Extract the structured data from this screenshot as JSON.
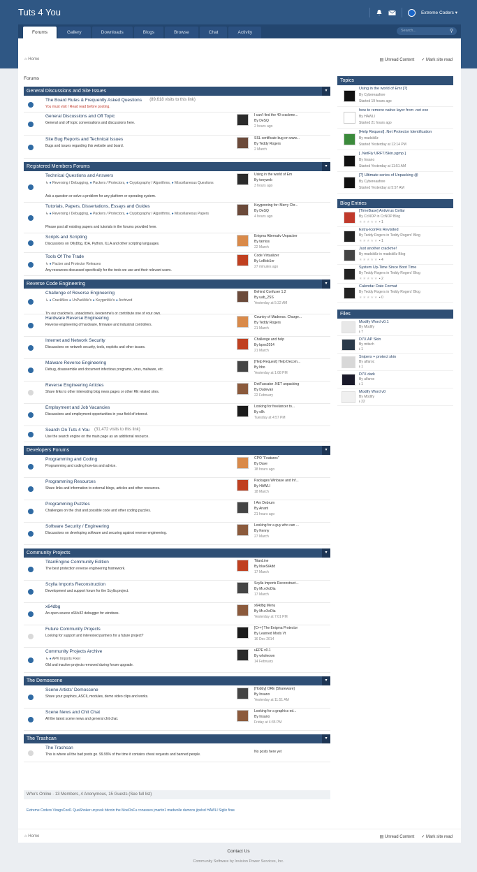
{
  "site": {
    "title": "Tuts 4 You"
  },
  "user": {
    "name": "Extreme Coders ▾"
  },
  "nav": {
    "tabs": [
      "Forums",
      "Gallery",
      "Downloads",
      "Blogs",
      "Browse",
      "Chat",
      "Activity"
    ],
    "search_placeholder": "Search..."
  },
  "breadcrumb": {
    "home": "Home",
    "unread": "Unread Content",
    "mark_read": "Mark site read"
  },
  "forum_label": "Forums",
  "categories": [
    {
      "title": "General Discussions and Site Issues",
      "rows": [
        {
          "title": "The Board Rules & Frequently Asked Questions",
          "extra": "(89,618 visits to this link)",
          "desc": "You must visit / Read read before posting.",
          "red": true,
          "h": 23
        },
        {
          "title": "General Discussions and Off Topic",
          "desc": "General and off topic conversations and discussions here.",
          "lp": [
            "I can't find the 40 crackme...",
            "By DeSQ",
            "2 hours ago"
          ],
          "h": 33
        },
        {
          "title": "Site Bug Reports and Technical Issues",
          "desc": "Bugs and issues regarding this website and board.",
          "lp": [
            "SSL certificate bug on www...",
            "By Teddy Rogers",
            "2 March"
          ],
          "h": 33
        }
      ]
    },
    {
      "title": "Registered Members Forums",
      "rows": [
        {
          "title": "Technical Questions and Answers",
          "subs": [
            "Reversing / Debugging,",
            "Packers / Protectors,",
            "Cryptography / Algorithms,",
            "Miscellaneous Questions"
          ],
          "desc": "Ask a question or solve a problem for any platform or operating system.",
          "lp": [
            "Using in the world of Em",
            "By tonyweb",
            "3 hours ago"
          ],
          "h": 44
        },
        {
          "title": "Tutorials, Papers, Dissertations, Essays and Guides",
          "subs": [
            "Reversing / Debugging,",
            "Packers / Protectors,",
            "Cryptography / Algorithms,",
            "Miscellaneous Papers"
          ],
          "desc": "Please post all existing papers and tutorials in the forums provided here.",
          "lp": [
            "Keygenning for: Merry Chr...",
            "By DeSQ",
            "4 hours ago"
          ],
          "h": 44
        },
        {
          "title": "Scripts and Scripting",
          "desc": "Discussions on OllyDbg, IDA, Python, ILLA and other scripting languages.",
          "lp": [
            "Enigma Alternativ Unpacker",
            "By tarniss",
            "22 March"
          ],
          "h": 28
        },
        {
          "title": "Tools Of The Trade",
          "subs": [
            "Packer and Protector Releases"
          ],
          "desc": "Any resources discussed specifically for the tools we use and their relevant users.",
          "lp": [
            "Code Virtualizer",
            "By LeBob1er",
            "27 minutes ago"
          ],
          "h": 33
        }
      ]
    },
    {
      "title": "Reverse Code Engineering",
      "rows": [
        {
          "title": "Challenge of Reverse Engineering",
          "subs": [
            "CrackMes",
            "UnPackMe's",
            "KeygenMe's",
            "Archived"
          ],
          "desc": "Try our crackme's, unpackme's, keygenme's or contribute one of your own.",
          "lp": [
            "Behind Confuser 1.2",
            "By uab_2SS",
            "Yesterday at 5:32 AM"
          ],
          "h": 36
        },
        {
          "title": "Hardware Reverse Engineering",
          "desc": "Reverse engineering of hardware, firmware and industrial controllers.",
          "lp": [
            "Country of Madness. Charge...",
            "By Teddy Rogers",
            "21 March"
          ],
          "h": 32
        },
        {
          "title": "Internet and Network Security",
          "desc": "Discussions on network security, tools, exploits and other issues.",
          "lp": [
            "Challenge and help",
            "By bpvs2014",
            "21 March"
          ],
          "h": 32
        },
        {
          "title": "Malware Reverse Engineering",
          "desc": "Debug, disassemble and document infectious programs, virus, malware, etc.",
          "lp": [
            "[Help Request] Help Decom...",
            "By hbo",
            "Yesterday at 1:08 PM"
          ],
          "h": 32
        },
        {
          "title": "Reverse Engineering Articles",
          "desc": "Share links to other interesting blog news pages or other RE related sites.",
          "lp": [
            "DotFuscator .NET unpacking",
            "By Dudevan",
            "22 February"
          ],
          "h": 32,
          "dim": true
        },
        {
          "title": "Employment and Job Vacancies",
          "desc": "Discussions and employment opportunities in your field of interest.",
          "lp": [
            "Looking for freelancer to...",
            "By ollk",
            "Tuesday at 4:57 PM"
          ],
          "h": 32
        },
        {
          "title": "Search On Tuts 4 You",
          "extra": "(31,472 visits to this link)",
          "desc": "Use the search engine on the main page as an additional resource.",
          "h": 23
        }
      ]
    },
    {
      "title": "Developers Forums",
      "rows": [
        {
          "title": "Programming and Coding",
          "desc": "Programming and coding how-tos and advice.",
          "lp": [
            "CPO \"Features\"",
            "By Dave",
            "18 hours ago"
          ],
          "h": 32
        },
        {
          "title": "Programming Resources",
          "desc": "Share links and information to external blogs, articles and other resources.",
          "lp": [
            "Packages Winbase and Inf...",
            "By HAWLI",
            "18 March"
          ],
          "h": 32
        },
        {
          "title": "Programming Puzzles",
          "desc": "Challenges on the chat and possible code and other coding puzzles.",
          "lp": [
            "I Am Debrum",
            "By Anant",
            "21 hours ago"
          ],
          "h": 32
        },
        {
          "title": "Software Security / Engineering",
          "desc": "Discussions on developing software and securing against reverse engineering.",
          "lp": [
            "Looking for a guy who can ...",
            "By Kenny",
            "27 March"
          ],
          "h": 32
        }
      ]
    },
    {
      "title": "Community Projects",
      "rows": [
        {
          "title": "TitanEngine Community Edition",
          "desc": "The best protection reverse engineering framework.",
          "lp": [
            "TitanLine",
            "By blueSiAdd",
            "17 March"
          ],
          "h": 32
        },
        {
          "title": "Scylla Imports Reconstruction",
          "desc": "Development and support forum for the Scylla project.",
          "lp": [
            "Scylla Imports Reconstruct...",
            "By Mr.eXoDia",
            "17 March"
          ],
          "h": 32
        },
        {
          "title": "x64dbg",
          "desc": "An open-source x64/x32 debugger for windows.",
          "lp": [
            "x64dbg Menu",
            "By Mr.eXoDia",
            "Yesterday at 7:01 PM"
          ],
          "h": 32
        },
        {
          "title": "Future Community Projects",
          "desc": "Looking for support and interested partners for a future project?",
          "lp": [
            "[C++] The Enigma Protector",
            "By Learned Mods Vt",
            "16 Dec 2014"
          ],
          "h": 32,
          "dim": true
        },
        {
          "title": "Community Projects Archive",
          "subs": [
            "APK Imports Fixer"
          ],
          "desc": "Old and inactive projects removed during forum upgrade.",
          "lp": [
            "uEPE v0.1",
            "By wholeown",
            "14 February"
          ],
          "h": 36
        }
      ]
    },
    {
      "title": "The Demoscene",
      "rows": [
        {
          "title": "Scene Artists' Demoscene",
          "desc": "Share your graphics, ASCII, modules, demo video clips and works.",
          "lp": [
            "[Hobby] ORE [Shareware]",
            "By Insano",
            "Yesterday at 11:51 AM"
          ],
          "h": 32
        },
        {
          "title": "Scene News and Chit Chat",
          "desc": "All the latest scene news and general chit chat.",
          "lp": [
            "Looking for a graphics ed...",
            "By Insano",
            "Friday at 4:35 PM"
          ],
          "h": 32
        }
      ]
    },
    {
      "title": "The Trashcan",
      "rows": [
        {
          "title": "The Trashcan",
          "desc": "This is where all the bad posts go. 99.99% of the time it contains cheat requests and banned people.",
          "lp": [
            "No posts here yet",
            "",
            ""
          ],
          "h": 26,
          "dim": true,
          "empty": true
        }
      ]
    }
  ],
  "online": {
    "title": "Who's Online",
    "text": "13 Members, 4 Anonymous, 15 Guests (See full list)",
    "names": "Extreme Coders  ViragoCool1  QuaShoker  unyrusk  bitcoin  the MoeDoFu  conasseo  jmartin1  madwolle  damcos  jipvlsd  HAWLI  Siglix  firas"
  },
  "sidebar": {
    "topics_title": "Topics",
    "topics": [
      {
        "title": "Using in the world of Emr [?]",
        "by": "By Cybereaafore",
        "time": "Started 19 hours ago"
      },
      {
        "title": "how to remove native layer from .net exe",
        "by": "By HAWLI",
        "time": "Started 21 hours ago"
      },
      {
        "title": "[Help Request] .Net Protector Identification",
        "by": "By madskillz",
        "time": "Started Yesterday at 12:14 PM"
      },
      {
        "title": "[ .NetFly URFT/Skin.ygmp ]",
        "by": "By Insano",
        "time": "Started Yesterday at 11:51 AM"
      },
      {
        "title": "[?] Ultimate series of Unpacking @",
        "by": "By Cybereaafore",
        "time": "Started Yesterday at 5:57 AM"
      }
    ],
    "blog_title": "Blog Entries",
    "blogs": [
      {
        "title": "[TimeBase] Antivirus Cellar",
        "by": "By CcNOP in CcNOP Blog",
        "count": "1"
      },
      {
        "title": "Extra-IconFix Revisited",
        "by": "By Teddy Rogers in Teddy Rogers' Blog",
        "count": "1"
      },
      {
        "title": "Just another crackme!",
        "by": "By madskillz in madskillz Blog",
        "count": "4"
      },
      {
        "title": "System Up-Time Since Boot Time",
        "by": "By Teddy Rogers in Teddy Rogers' Blog",
        "count": "2"
      },
      {
        "title": "Calendar Date Format",
        "by": "By Teddy Rogers in Teddy Rogers' Blog",
        "count": "0"
      }
    ],
    "files_title": "Files",
    "files": [
      {
        "title": "Modify Word v0.1",
        "by": "By Modify",
        "count": "7"
      },
      {
        "title": "D7X AP Skin",
        "by": "By mitsch",
        "count": "1"
      },
      {
        "title": "Snipers + protect skin",
        "by": "By alfaroc",
        "count": "1"
      },
      {
        "title": "D7X dark",
        "by": "By alfaroc",
        "count": "1"
      },
      {
        "title": "Modify Word v0",
        "by": "By Modify",
        "count": "22"
      }
    ]
  },
  "footer": {
    "contact": "Contact Us",
    "powered": "Community Software by Invision Power Services, Inc."
  }
}
